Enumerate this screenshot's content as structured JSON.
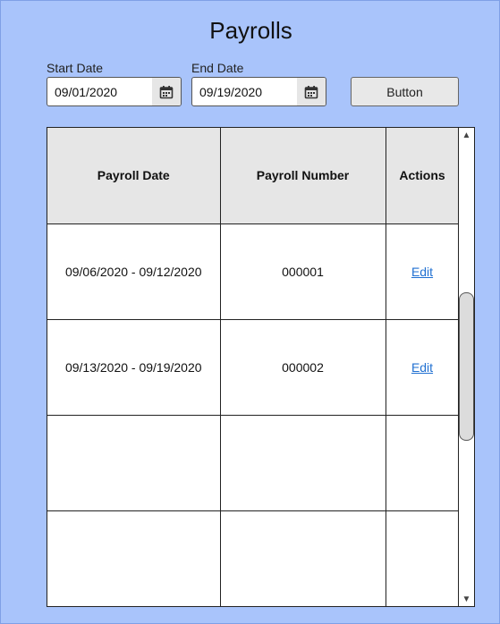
{
  "title": "Payrolls",
  "filters": {
    "start_label": "Start Date",
    "start_value": "09/01/2020",
    "end_label": "End Date",
    "end_value": "09/19/2020",
    "button_label": "Button"
  },
  "table": {
    "headers": [
      "Payroll Date",
      "Payroll Number",
      "Actions"
    ],
    "rows": [
      {
        "date": "09/06/2020 - 09/12/2020",
        "number": "000001",
        "action": "Edit"
      },
      {
        "date": "09/13/2020 - 09/19/2020",
        "number": "000002",
        "action": "Edit"
      },
      {
        "date": "",
        "number": "",
        "action": ""
      },
      {
        "date": "",
        "number": "",
        "action": ""
      }
    ]
  },
  "icons": {
    "start_calendar": "calendar-icon",
    "end_calendar": "calendar-icon",
    "scroll_up": "triangle-up-icon",
    "scroll_down": "triangle-down-icon"
  },
  "colors": {
    "background": "#a9c4fb",
    "header_fill": "#e6e6e6",
    "link": "#1f6fd1"
  }
}
